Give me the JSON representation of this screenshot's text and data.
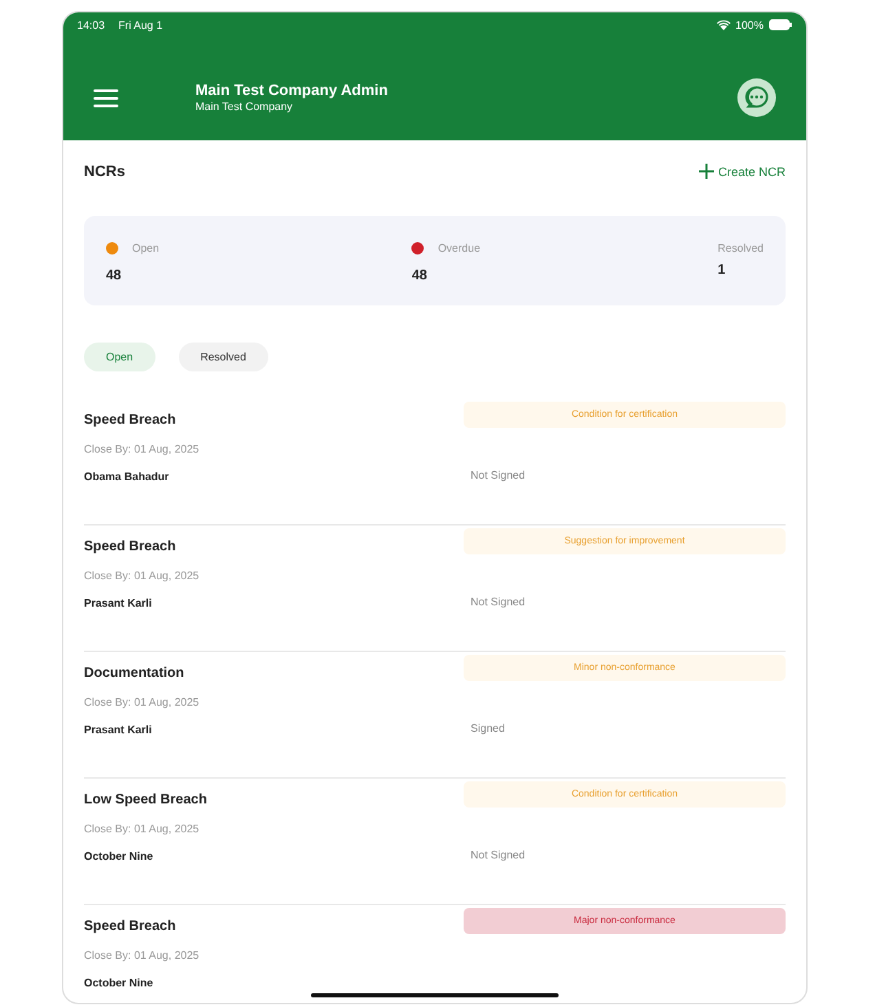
{
  "status_bar": {
    "time": "14:03",
    "date": "Fri Aug 1",
    "battery": "100%"
  },
  "header": {
    "title": "Main Test Company Admin",
    "subtitle": "Main Test Company"
  },
  "page": {
    "title": "NCRs",
    "action": "Create NCR"
  },
  "stats": [
    {
      "label": "Open",
      "value": "48",
      "color": "#ee8a0e"
    },
    {
      "label": "Overdue",
      "value": "48",
      "color": "#d0202a"
    },
    {
      "label": "Resolved",
      "value": "1"
    }
  ],
  "tabs": [
    {
      "label": "Open",
      "selected": true
    },
    {
      "label": "Resolved",
      "selected": false
    }
  ],
  "ncrs": [
    {
      "title": "Speed Breach",
      "close_by": "Close By: 01 Aug, 2025",
      "person": "Obama Bahadur",
      "category": "Condition for certification",
      "kind": "minor",
      "signature": "Not Signed"
    },
    {
      "title": "Speed Breach",
      "close_by": "Close By: 01 Aug, 2025",
      "person": "Prasant Karli",
      "category": "Suggestion for improvement",
      "kind": "minor",
      "signature": "Not Signed"
    },
    {
      "title": "Documentation",
      "close_by": "Close By: 01 Aug, 2025",
      "person": "Prasant Karli",
      "category": "Minor non-conformance",
      "kind": "minor",
      "signature": "Signed"
    },
    {
      "title": "Low Speed Breach",
      "close_by": "Close By: 01 Aug, 2025",
      "person": "October Nine",
      "category": "Condition for certification",
      "kind": "minor",
      "signature": "Not Signed"
    },
    {
      "title": "Speed Breach",
      "close_by": "Close By: 01 Aug, 2025",
      "person": "October Nine",
      "category": "Major non-conformance",
      "kind": "major"
    }
  ]
}
